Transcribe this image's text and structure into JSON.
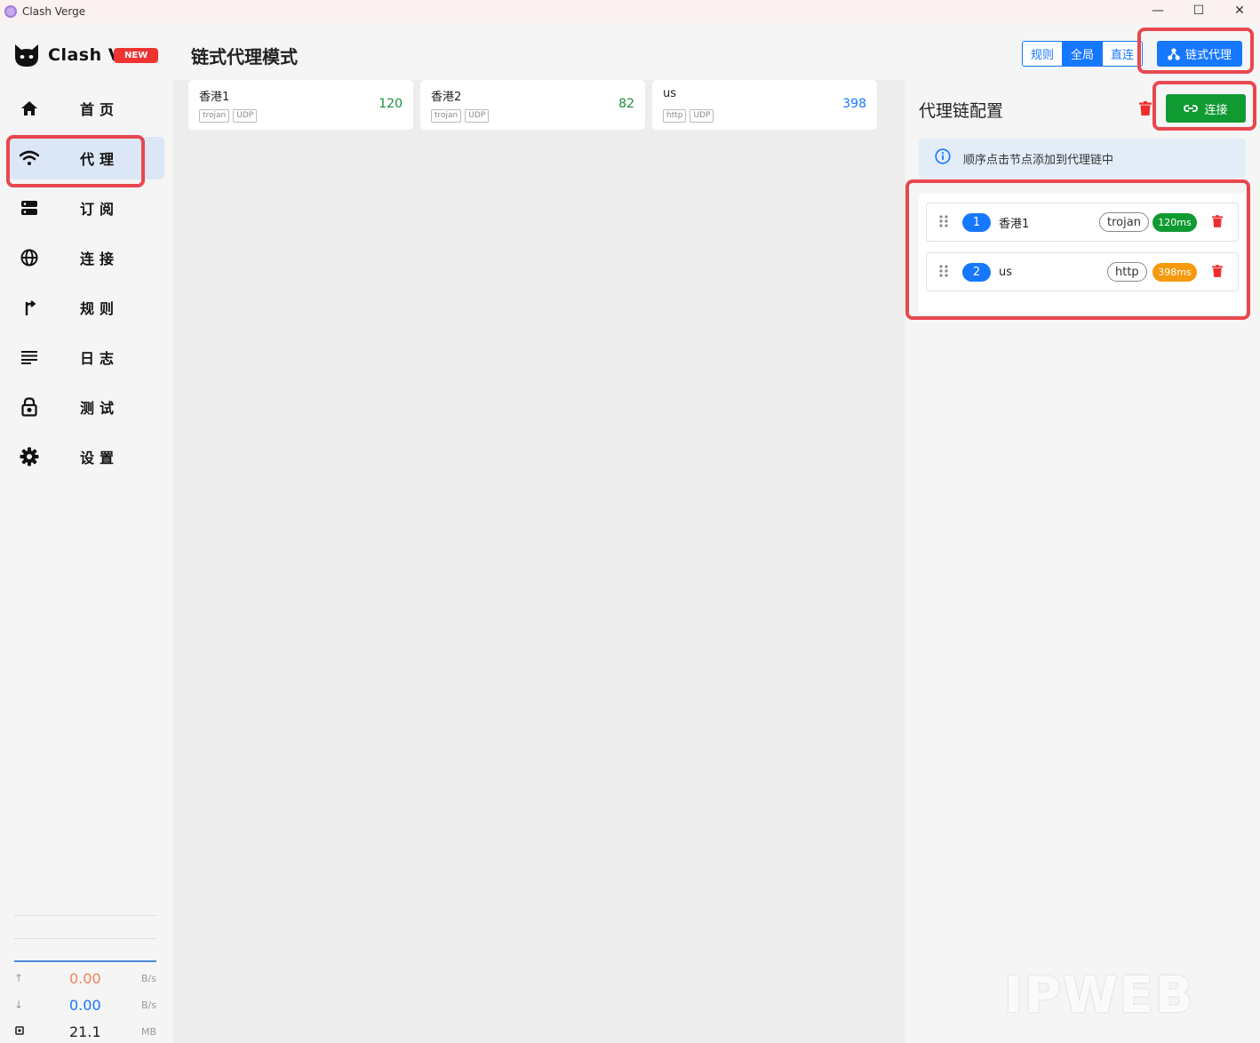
{
  "window": {
    "title": "Clash Verge",
    "minimize": "—",
    "maximize": "☐",
    "close": "✕"
  },
  "sidebar": {
    "logo_text": "Clash V",
    "new_badge": "NEW",
    "items": [
      {
        "label": "首页",
        "icon": "home-icon"
      },
      {
        "label": "代理",
        "icon": "wifi-icon",
        "active": true
      },
      {
        "label": "订阅",
        "icon": "server-icon"
      },
      {
        "label": "连接",
        "icon": "globe-icon"
      },
      {
        "label": "规则",
        "icon": "route-icon"
      },
      {
        "label": "日志",
        "icon": "list-icon"
      },
      {
        "label": "测试",
        "icon": "lock-icon"
      },
      {
        "label": "设置",
        "icon": "gear-icon"
      }
    ],
    "traffic": {
      "upload": {
        "value": "0.00",
        "unit": "B/s",
        "color": "#f0845a"
      },
      "download": {
        "value": "0.00",
        "unit": "B/s",
        "color": "#1677ff"
      },
      "memory": {
        "value": "21.1",
        "unit": "MB"
      }
    }
  },
  "header": {
    "title": "链式代理模式",
    "modes": [
      "规则",
      "全局",
      "直连"
    ],
    "selected_mode": "全局",
    "chain_button": "链式代理"
  },
  "proxies": [
    {
      "name": "香港1",
      "delay": "120",
      "tags": [
        "trojan",
        "UDP"
      ],
      "delay_color": "#1a8f3a"
    },
    {
      "name": "香港2",
      "delay": "82",
      "tags": [
        "trojan",
        "UDP"
      ],
      "delay_color": "#1a8f3a"
    },
    {
      "name": "us",
      "delay": "398",
      "tags": [
        "http",
        "UDP"
      ],
      "delay_color": "#1677ff"
    }
  ],
  "chain_panel": {
    "title": "代理链配置",
    "connect_button": "连接",
    "info": "顺序点击节点添加到代理链中",
    "items": [
      {
        "order": "1",
        "name": "香港1",
        "type": "trojan",
        "delay": "120ms",
        "delay_color": "#109a32"
      },
      {
        "order": "2",
        "name": "us",
        "type": "http",
        "delay": "398ms",
        "delay_color": "#f59a0c"
      }
    ]
  },
  "watermark": "IPWEB",
  "colors": {
    "accent": "#1677ff",
    "highlight": "#e8474f",
    "connect": "#109a32"
  }
}
